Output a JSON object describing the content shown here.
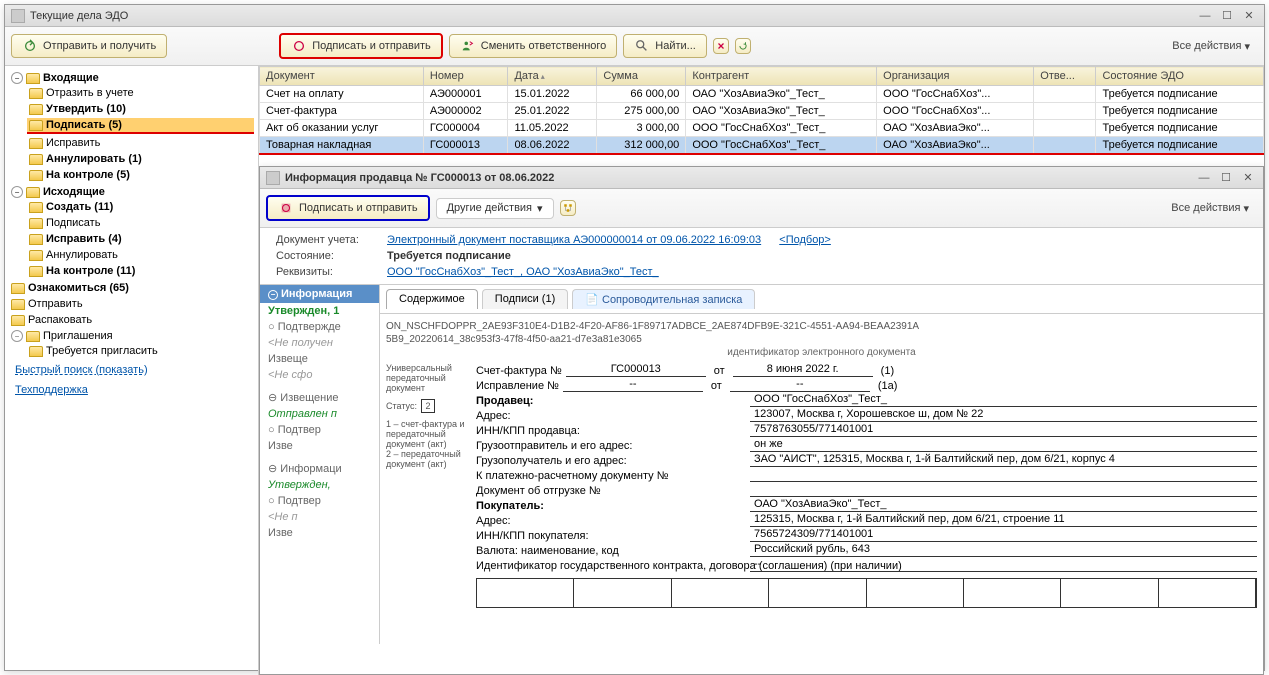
{
  "main_window": {
    "title": "Текущие дела ЭДО",
    "toolbar": {
      "send_receive": "Отправить и получить",
      "sign_send": "Подписать и отправить",
      "change_responsible": "Сменить ответственного",
      "find": "Найти...",
      "all_actions": "Все действия"
    },
    "tree": {
      "incoming": "Входящие",
      "reflect": "Отразить в учете",
      "approve": "Утвердить (10)",
      "sign": "Подписать (5)",
      "fix": "Исправить",
      "cancel": "Аннулировать (1)",
      "control": "На контроле (5)",
      "outgoing": "Исходящие",
      "create": "Создать (11)",
      "sign2": "Подписать",
      "fix2": "Исправить (4)",
      "cancel2": "Аннулировать",
      "control2": "На контроле (11)",
      "acquaint": "Ознакомиться (65)",
      "send": "Отправить",
      "unpack": "Распаковать",
      "invites": "Приглашения",
      "need_invite": "Требуется пригласить"
    },
    "quick_search": "Быстрый поиск (показать)",
    "support": "Техподдержка",
    "grid": {
      "headers": {
        "doc": "Документ",
        "num": "Номер",
        "date": "Дата",
        "sum": "Сумма",
        "counter": "Контрагент",
        "org": "Организация",
        "resp": "Отве...",
        "state": "Состояние ЭДО"
      },
      "rows": [
        {
          "doc": "Счет на оплату",
          "num": "АЭ000001",
          "date": "15.01.2022",
          "sum": "66 000,00",
          "counter": "ОАО \"ХозАвиаЭко\"_Тест_",
          "org": "ООО \"ГосСнабХоз\"...",
          "state": "Требуется подписание"
        },
        {
          "doc": "Счет-фактура",
          "num": "АЭ000002",
          "date": "25.01.2022",
          "sum": "275 000,00",
          "counter": "ОАО \"ХозАвиаЭко\"_Тест_",
          "org": "ООО \"ГосСнабХоз\"...",
          "state": "Требуется подписание"
        },
        {
          "doc": "Акт об оказании услуг",
          "num": "ГС000004",
          "date": "11.05.2022",
          "sum": "3 000,00",
          "counter": "ООО \"ГосСнабХоз\"_Тест_",
          "org": "ОАО \"ХозАвиаЭко\"...",
          "state": "Требуется подписание"
        },
        {
          "doc": "Товарная накладная",
          "num": "ГС000013",
          "date": "08.06.2022",
          "sum": "312 000,00",
          "counter": "ООО \"ГосСнабХоз\"_Тест_",
          "org": "ОАО \"ХозАвиаЭко\"...",
          "state": "Требуется подписание"
        }
      ]
    }
  },
  "sub_window": {
    "title": "Информация продавца № ГС000013 от 08.06.2022",
    "toolbar": {
      "sign_send": "Подписать и отправить",
      "other": "Другие действия",
      "all_actions": "Все действия"
    },
    "info": {
      "doc_label": "Документ учета:",
      "doc_link": "Электронный документ поставщика АЭ000000014 от 09.06.2022 16:09:03",
      "selection": "<Подбор>",
      "state_label": "Состояние:",
      "state_val": "Требуется подписание",
      "req_label": "Реквизиты:",
      "req_val": "ООО \"ГосСнабХоз\"_Тест_, ОАО \"ХозАвиаЭко\"_Тест_"
    },
    "left": {
      "info_tab": "Информация",
      "approved": "Утвержден, 1",
      "confirm": "Подтвержде",
      "not_recv": "<Не получен",
      "notice_lbl": "Извеще",
      "not_formed": "<Не сфо",
      "notice2": "Извещение",
      "sent": "Отправлен п",
      "confirm2": "Подтвер",
      "izve": "Изве",
      "info2": "Информаци",
      "approved2": "Утвержден,",
      "confirm3": "Подтвер",
      "not_recv2": "<Не п",
      "izve2": "Изве"
    },
    "tabs": {
      "content": "Содержимое",
      "signs": "Подписи (1)",
      "note": "Сопроводительная записка"
    },
    "doc": {
      "id1": "ON_NSCHFDOPPR_2AE93F310E4-D1B2-4F20-AF86-1F89717ADBCE_2AE874DFB9E-321C-4551-AA94-BEAA2391A",
      "id2": "5B9_20220614_38c953f3-47f8-4f50-aa21-d7e3a81e3065",
      "id_label": "идентификатор электронного документа",
      "leftnote1": "Универсальный передаточный документ",
      "status_label": "Статус:",
      "status_val": "2",
      "leftnote2": "1 – счет-фактура и передаточный документ (акт)\n2 – передаточный документ (акт)",
      "invoice_label": "Счет-фактура №",
      "invoice_num": "ГС000013",
      "from": "от",
      "invoice_date": "8 июня 2022 г.",
      "n1": "(1)",
      "fix_label": "Исправление №",
      "fix_num": "--",
      "fix_date": "--",
      "n1a": "(1а)",
      "seller": "Продавец:",
      "seller_val": "ООО \"ГосСнабХоз\"_Тест_",
      "addr": "Адрес:",
      "addr_val": "123007, Москва г, Хорошевское ш, дом № 22",
      "inn": "ИНН/КПП продавца:",
      "inn_val": "7578763055/771401001",
      "sender": "Грузоотправитель и его адрес:",
      "sender_val": "он же",
      "recipient": "Грузополучатель и его адрес:",
      "recipient_val": "ЗАО \"АИСТ\", 125315, Москва г, 1-й Балтийский пер, дом 6/21, корпус 4",
      "payment": "К платежно-расчетному документу №",
      "payment_val": "",
      "shipment": "Документ об отгрузке №",
      "shipment_val": "",
      "buyer": "Покупатель:",
      "buyer_val": "ОАО \"ХозАвиаЭко\"_Тест_",
      "addr2": "Адрес:",
      "addr2_val": "125315, Москва г, 1-й Балтийский пер, дом 6/21, строение 11",
      "inn2": "ИНН/КПП покупателя:",
      "inn2_val": "7565724309/771401001",
      "currency": "Валюта: наименование, код",
      "currency_val": "Российский рубль, 643",
      "contract": "Идентификатор государственного контракта, договора (соглашения) (при наличии)",
      "contract_val": "--"
    }
  }
}
